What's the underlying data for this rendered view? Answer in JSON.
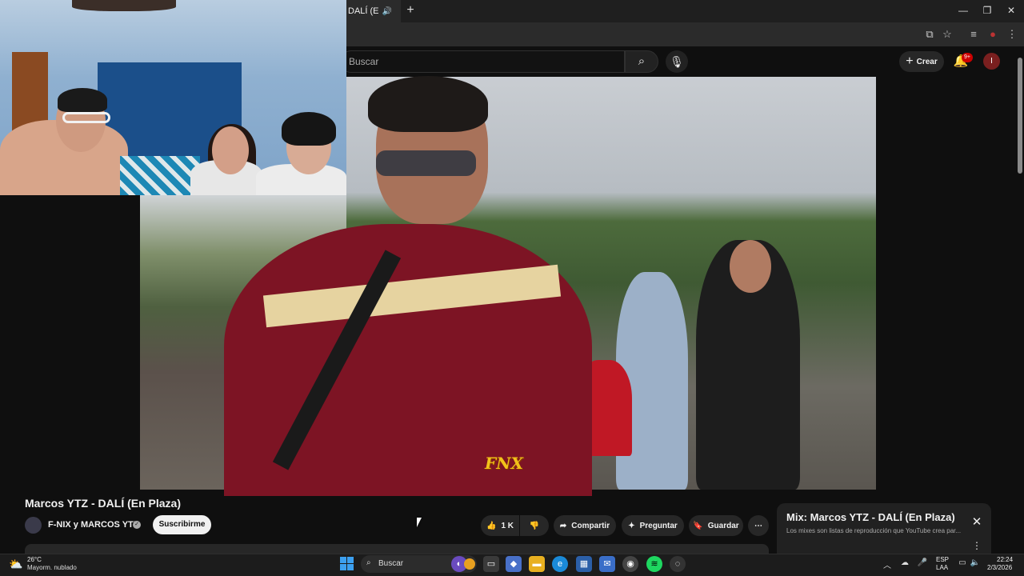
{
  "browser": {
    "tab_title": "DALÍ (E",
    "tab_sound_icon": "speaker-icon",
    "new_tab_label": "+",
    "window_controls": [
      "minimize",
      "maximize",
      "close"
    ]
  },
  "youtube_header": {
    "search_placeholder": "Buscar",
    "create_label": "Crear",
    "notifications_badge": "9+",
    "avatar_letter": "I"
  },
  "video": {
    "watermark": "FNX",
    "title": "Marcos YTZ - DALÍ (En Plaza)",
    "channel": "F-NIX y MARCOS YTZ",
    "subscribe_label": "Suscribirme",
    "like_count": "1 K",
    "share_label": "Compartir",
    "ask_label": "Preguntar",
    "save_label": "Guardar"
  },
  "mix_panel": {
    "title": "Mix: Marcos YTZ - DALÍ (En Plaza)",
    "subtitle": "Los mixes son listas de reproducción que YouTube crea par..."
  },
  "taskbar": {
    "weather_temp": "26°C",
    "weather_desc": "Mayorm. nublado",
    "search_label": "Buscar",
    "lang_code": "ESP",
    "lang_region": "LAA",
    "time": "22:24",
    "date": "2/3/2026"
  },
  "colors": {
    "bg": "#0f0f0f",
    "accent_red": "#cc0000",
    "pill": "#272727",
    "start_blue": "#3ca0f0"
  }
}
